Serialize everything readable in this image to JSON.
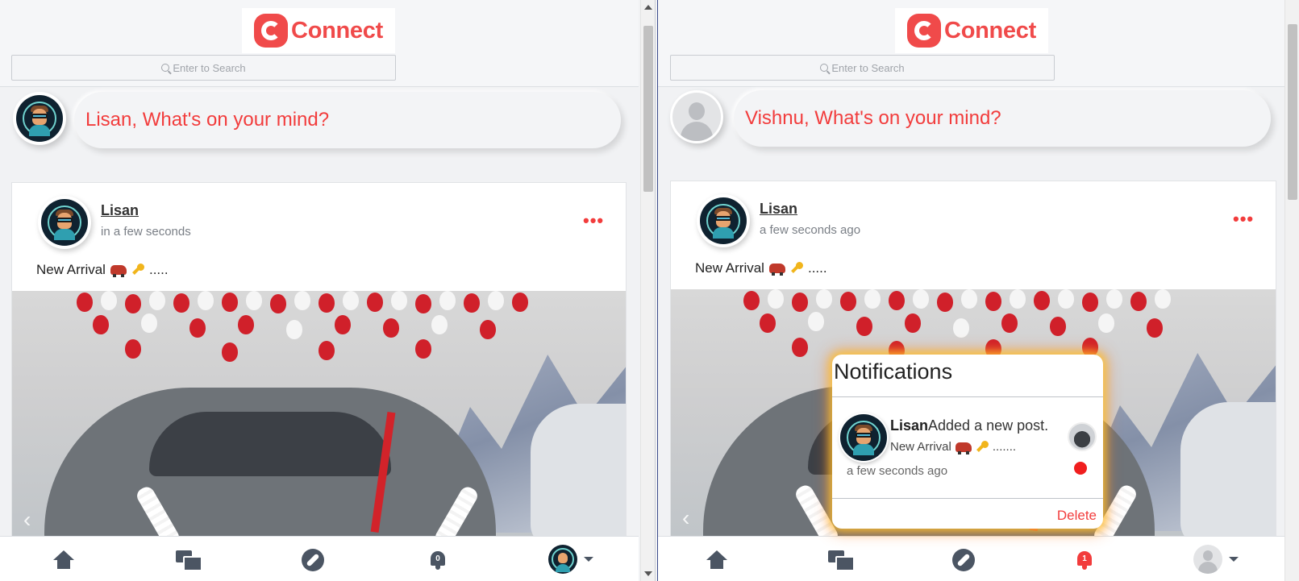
{
  "brand": {
    "name": "Connect",
    "color": "#f04a4a"
  },
  "search": {
    "placeholder": "Enter to Search"
  },
  "left": {
    "composer_prompt": "Lisan, What's on your mind?",
    "post": {
      "author": "Lisan",
      "time": "in a few seconds",
      "text": "New Arrival",
      "text_suffix": ".....",
      "menu": "•••"
    },
    "nav": {
      "notification_count": "0"
    }
  },
  "right": {
    "composer_prompt": "Vishnu, What's on your mind?",
    "post": {
      "author": "Lisan",
      "time": "a few seconds ago",
      "text": "New Arrival",
      "text_suffix": ".....",
      "menu": "•••"
    },
    "nav": {
      "notification_count": "1"
    },
    "notifications": {
      "title": "Notifications",
      "items": [
        {
          "actor": "Lisan",
          "action": "Added a new post.",
          "preview": "New Arrival",
          "preview_suffix": ".......",
          "time": "a few seconds ago"
        }
      ],
      "delete_label": "Delete"
    }
  },
  "icons": {
    "nav": [
      "home-icon",
      "chat-icon",
      "compass-icon",
      "bell-icon",
      "avatar"
    ],
    "emoji": [
      "car-emoji",
      "key-emoji"
    ]
  }
}
